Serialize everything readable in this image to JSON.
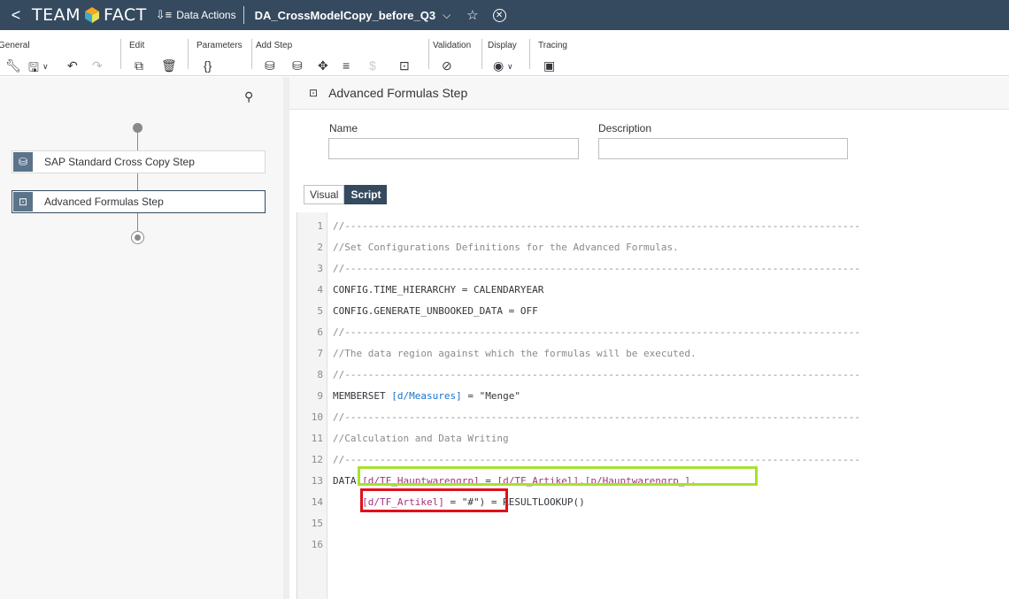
{
  "shell": {
    "back": "<",
    "brand_left": "TEAM",
    "brand_right": "FACT",
    "app_label": "Data Actions",
    "doc_title": "DA_CrossModelCopy_before_Q3"
  },
  "toolbar": {
    "general": "General",
    "edit": "Edit",
    "parameters": "Parameters",
    "add_step": "Add Step",
    "validation": "Validation",
    "display": "Display",
    "tracing": "Tracing"
  },
  "flow": {
    "steps": [
      {
        "label": "SAP Standard Cross Copy Step",
        "icon": "cube-icon"
      },
      {
        "label": "Advanced Formulas Step",
        "icon": "script-icon"
      }
    ]
  },
  "detail": {
    "title": "Advanced Formulas Step",
    "name_label": "Name",
    "name_value": "",
    "description_label": "Description",
    "description_value": "",
    "tabs": [
      "Visual",
      "Script"
    ],
    "active_tab": "Script"
  },
  "script": {
    "line_numbers": [
      "1",
      "2",
      "3",
      "4",
      "5",
      "6",
      "7",
      "8",
      "9",
      "10",
      "11",
      "12",
      "13",
      "14",
      "15",
      "16"
    ],
    "separator": "//----------------------------------------------------------------------------------------",
    "line2": "//Set Configurations Definitions for the Advanced Formulas.",
    "line4": "CONFIG.TIME_HIERARCHY = CALENDARYEAR",
    "line5": "CONFIG.GENERATE_UNBOOKED_DATA = OFF",
    "line7": "//The data region against which the formulas will be executed.",
    "line9_kw": "MEMBERSET ",
    "line9_dim": "[d/Measures]",
    "line9_rest": " = \"Menge\"",
    "line11": "//Calculation and Data Writing",
    "line13_kw": "DATA(",
    "line13_a": "[d/TF_Hauptwarengrp]",
    "line13_eq": " = ",
    "line13_b": "[d/TF_Artikel].[p/Hauptwarengrp_],",
    "line14_indent": "     ",
    "line14_a": "[d/TF_Artikel]",
    "line14_b": " = \"#\")",
    "line14_c": " = RESULTLOOKUP()"
  },
  "colors": {
    "shell_bg": "#354a5f",
    "highlight_green": "#a6e22e",
    "highlight_red": "#e0101a"
  }
}
